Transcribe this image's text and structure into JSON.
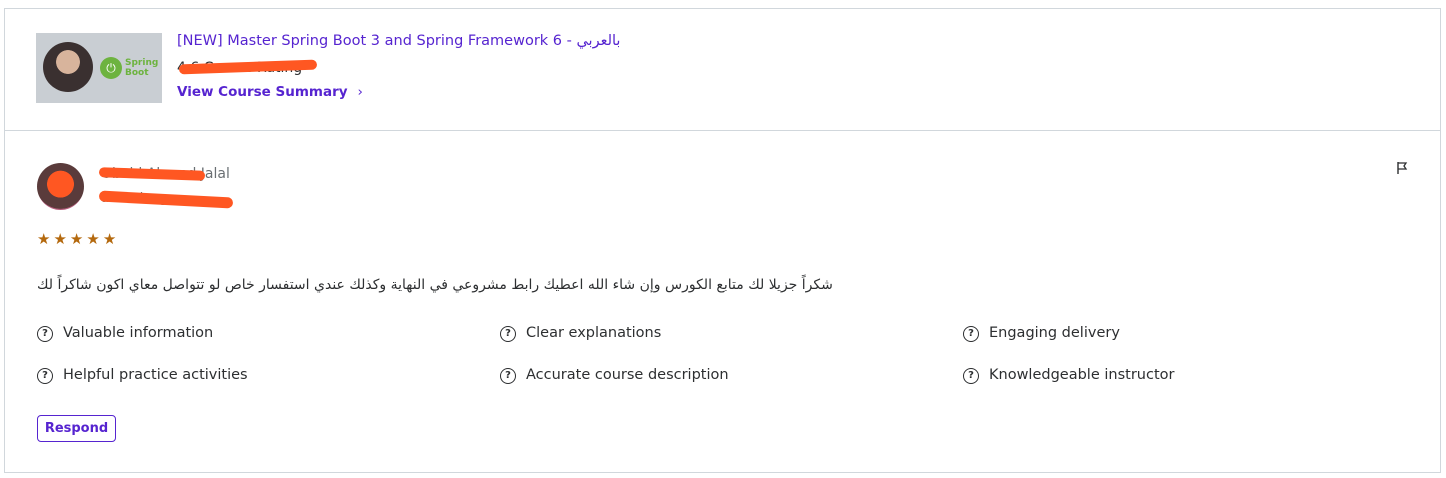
{
  "course": {
    "title": "[NEW] Master Spring Boot 3 and Spring Framework 6 - بالعربي",
    "rating_text": "4.6 Course Rating",
    "summary_link": "View Course Summary",
    "chevron": "›",
    "thumbnail_logo_text": "Spring Boot"
  },
  "review": {
    "reviewer_name": "Obeid Ahmed Jalal",
    "date": "a week ago",
    "rating": 5,
    "stars": [
      "★",
      "★",
      "★",
      "★",
      "★"
    ],
    "comment": "شكراً جزيلا لك متابع الكورس وإن شاء الله اعطيك رابط مشروعي في النهاية وكذلك عندي استفسار خاص لو تتواصل معاي اكون شاكراً لك",
    "tags": [
      "Valuable information",
      "Clear explanations",
      "Engaging delivery",
      "Helpful practice activities",
      "Accurate course description",
      "Knowledgeable instructor"
    ],
    "respond_label": "Respond"
  },
  "icons": {
    "tag_icon": "question-circle-icon",
    "flag_icon": "flag-icon",
    "star_icon": "star-icon"
  },
  "colors": {
    "accent": "#5624d0",
    "star": "#b4690e",
    "redaction": "#ff5722",
    "border": "#d1d7dc"
  }
}
